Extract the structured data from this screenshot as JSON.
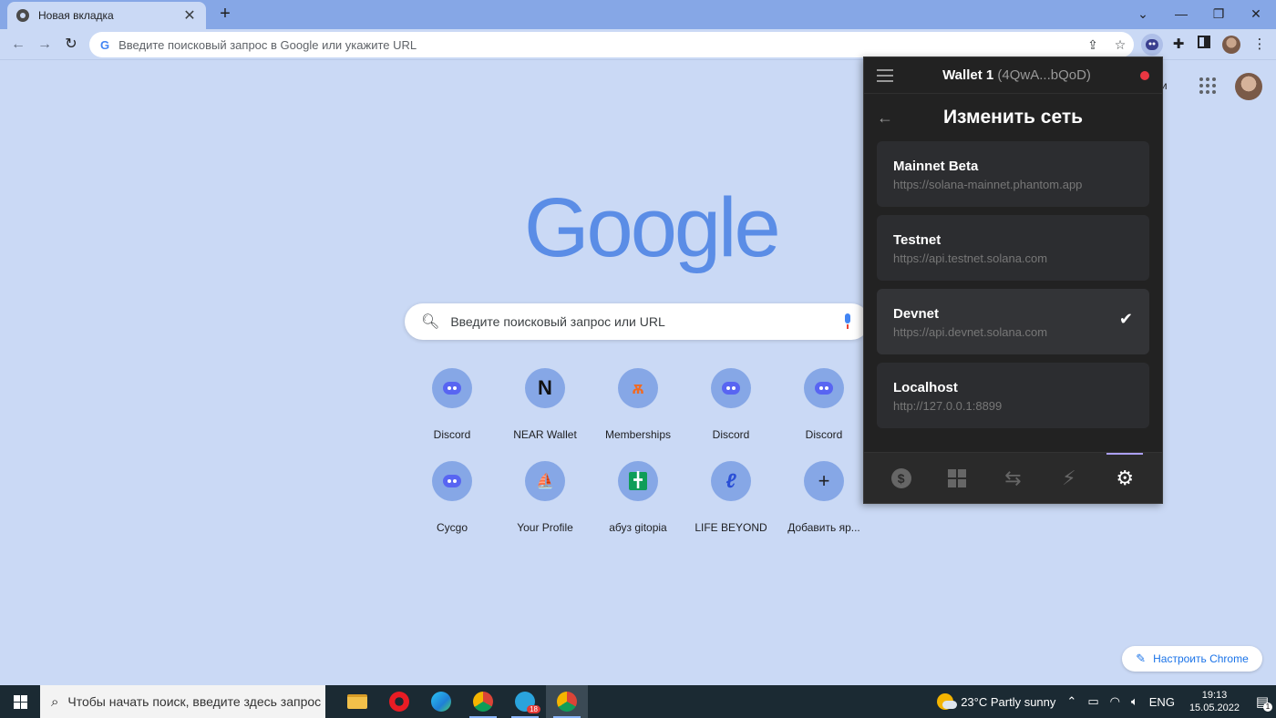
{
  "browser": {
    "tab_title": "Новая вкладка",
    "tab_close": "✕",
    "new_tab": "+",
    "window_controls": {
      "collapse_tabs": "⌄",
      "minimize": "—",
      "maximize": "❐",
      "close": "✕"
    },
    "nav": {
      "back": "←",
      "forward": "→",
      "reload": "↻"
    },
    "omnibox": {
      "google_g": "G",
      "placeholder": "Введите поисковый запрос в Google или укажите URL"
    }
  },
  "ntp": {
    "topright_text": "нки",
    "logo": "Google",
    "search_placeholder": "Введите поисковый запрос или URL",
    "shortcuts": [
      {
        "label": "Discord",
        "icon": "discord-icon"
      },
      {
        "label": "NEAR Wallet",
        "icon": "near-icon",
        "glyph": "N"
      },
      {
        "label": "Memberships",
        "icon": "fnatic-icon",
        "glyph": "ѫ"
      },
      {
        "label": "Discord",
        "icon": "discord-icon"
      },
      {
        "label": "Discord",
        "icon": "discord-icon"
      },
      {
        "label": "Cycgo",
        "icon": "discord-icon"
      },
      {
        "label": "Your Profile",
        "icon": "opensea-icon",
        "glyph": "⛵"
      },
      {
        "label": "абуз gitopia",
        "icon": "gitopia-icon",
        "glyph": "╋"
      },
      {
        "label": "LIFE BEYOND",
        "icon": "lifebeyond-icon",
        "glyph": "ℓ"
      },
      {
        "label": "Добавить яр...",
        "icon": "plus-icon",
        "glyph": "+"
      }
    ],
    "customize_label": "Настроить Chrome"
  },
  "phantom": {
    "wallet_name": "Wallet 1",
    "wallet_address": "(4QwA...bQoD)",
    "title": "Изменить сеть",
    "networks": [
      {
        "name": "Mainnet Beta",
        "url": "https://solana-mainnet.phantom.app",
        "selected": false
      },
      {
        "name": "Testnet",
        "url": "https://api.testnet.solana.com",
        "selected": false
      },
      {
        "name": "Devnet",
        "url": "https://api.devnet.solana.com",
        "selected": true
      },
      {
        "name": "Localhost",
        "url": "http://127.0.0.1:8899",
        "selected": false
      }
    ],
    "footer_tabs": [
      "wallet-tab",
      "collectibles-tab",
      "swap-tab",
      "activity-tab",
      "settings-tab"
    ],
    "accent_color": "#ab9ff2"
  },
  "taskbar": {
    "search_placeholder": "Чтобы начать поиск, введите здесь запрос",
    "weather": "23°C  Partly sunny",
    "language": "ENG",
    "time": "19:13",
    "date": "15.05.2022",
    "telegram_badge": "18",
    "notifications": "1"
  }
}
